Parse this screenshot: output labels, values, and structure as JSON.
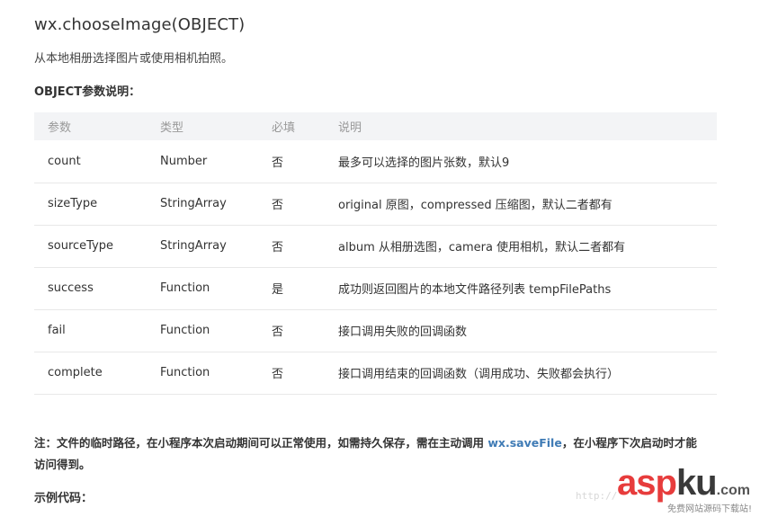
{
  "doc": {
    "title": "wx.chooseImage(OBJECT)",
    "description": "从本地相册选择图片或使用相机拍照。",
    "params_label": "OBJECT参数说明：",
    "table": {
      "headers": [
        "参数",
        "类型",
        "必填",
        "说明"
      ],
      "rows": [
        [
          "count",
          "Number",
          "否",
          "最多可以选择的图片张数，默认9"
        ],
        [
          "sizeType",
          "StringArray",
          "否",
          "original 原图，compressed 压缩图，默认二者都有"
        ],
        [
          "sourceType",
          "StringArray",
          "否",
          "album 从相册选图，camera 使用相机，默认二者都有"
        ],
        [
          "success",
          "Function",
          "是",
          "成功则返回图片的本地文件路径列表 tempFilePaths"
        ],
        [
          "fail",
          "Function",
          "否",
          "接口调用失败的回调函数"
        ],
        [
          "complete",
          "Function",
          "否",
          "接口调用结束的回调函数（调用成功、失败都会执行）"
        ]
      ]
    },
    "note": {
      "before": "注：文件的临时路径，在小程序本次启动期间可以正常使用，如需持久保存，需在主动调用 ",
      "link": "wx.saveFile",
      "after": "，在小程序下次启动时才能访问得到。"
    },
    "example_label": "示例代码："
  },
  "watermark": {
    "url_text": "http://",
    "logo_a": "asp",
    "logo_k": "ku",
    "logo_com": ".com",
    "sub_text": "免费网站源码下载站!"
  },
  "colors": {
    "link": "#3f7bb5",
    "header_bg": "#f3f4f6",
    "logo_red": "#e73c3c"
  }
}
